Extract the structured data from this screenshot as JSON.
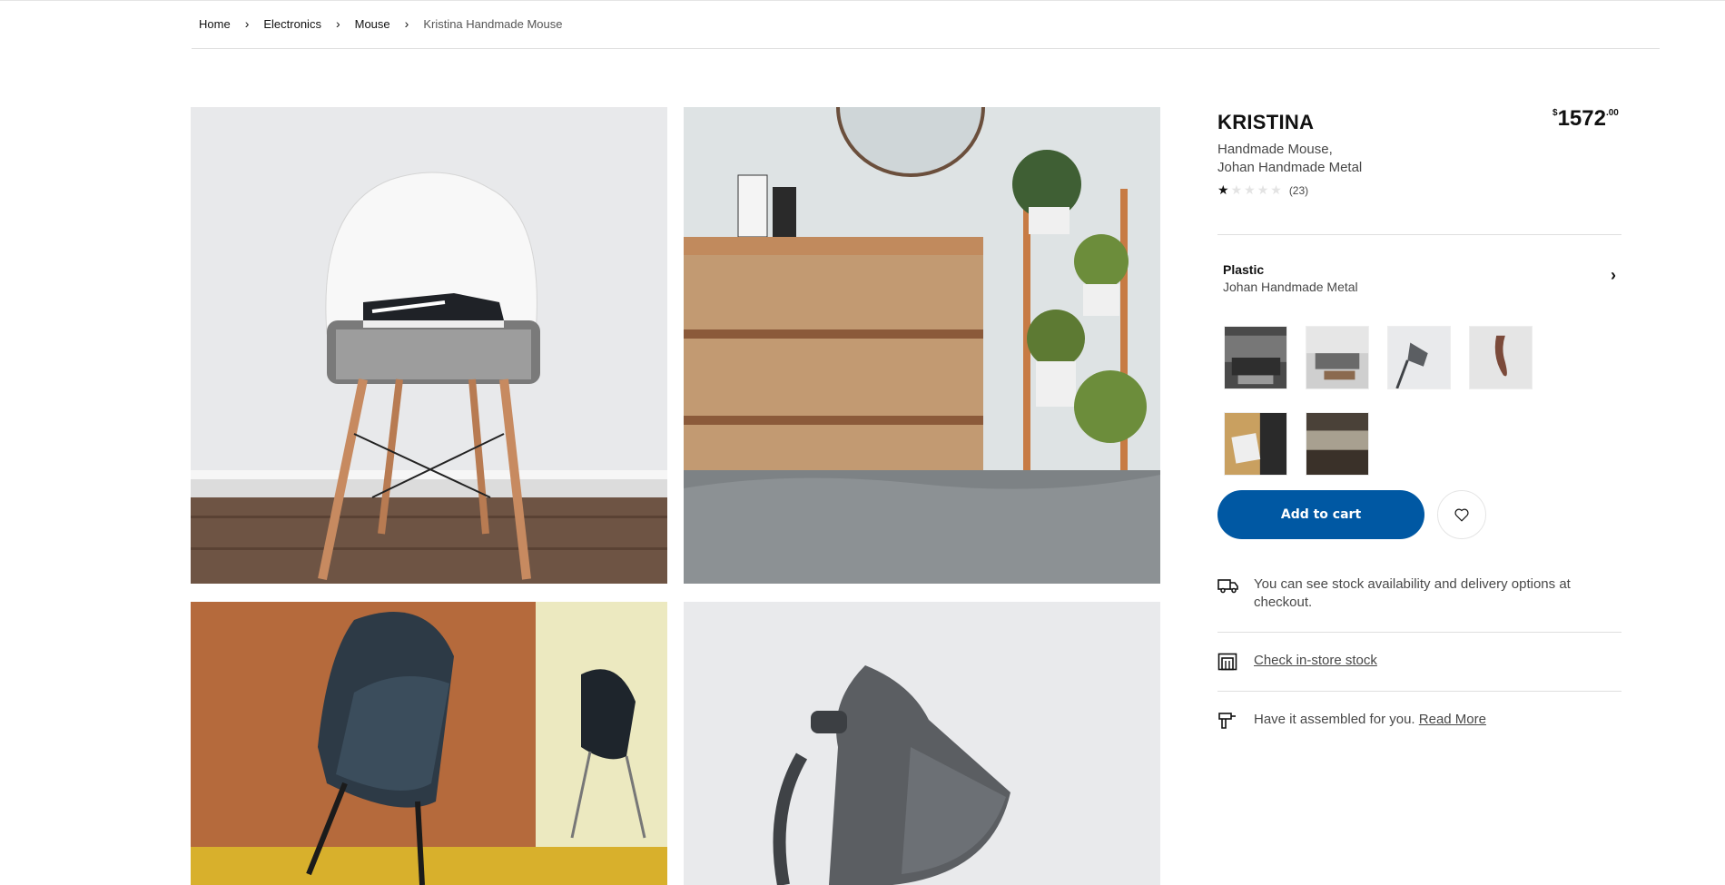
{
  "breadcrumb": {
    "items": [
      "Home",
      "Electronics",
      "Mouse"
    ],
    "current": "Kristina Handmade Mouse",
    "separator": "›"
  },
  "product": {
    "name": "KRISTINA",
    "subtitle_line1": "Handmade Mouse,",
    "subtitle_line2": "Johan Handmade Metal",
    "price": {
      "currency": "$",
      "whole": "1572",
      "cents": ".00"
    },
    "rating": {
      "stars": 1,
      "out_of": 5,
      "count_label": "(23)"
    }
  },
  "variant": {
    "title": "Plastic",
    "subtitle": "Johan Handmade Metal",
    "chevron": "›"
  },
  "thumbnails": [
    "thumb-living-room-dark",
    "thumb-living-room-sofa",
    "thumb-lamp",
    "thumb-hanging-rope",
    "thumb-book-table",
    "thumb-office-hall"
  ],
  "actions": {
    "add_to_cart": "Add to cart",
    "favorite_icon": "heart-icon"
  },
  "info_rows": {
    "delivery_text": "You can see stock availability and delivery options at checkout.",
    "store_link": "Check in-store stock",
    "assembly_text": "Have it assembled for you.",
    "assembly_link": "Read More"
  },
  "colors": {
    "primary_button": "#0058a3",
    "divider": "#dfdfdf",
    "text_secondary": "#484848"
  }
}
